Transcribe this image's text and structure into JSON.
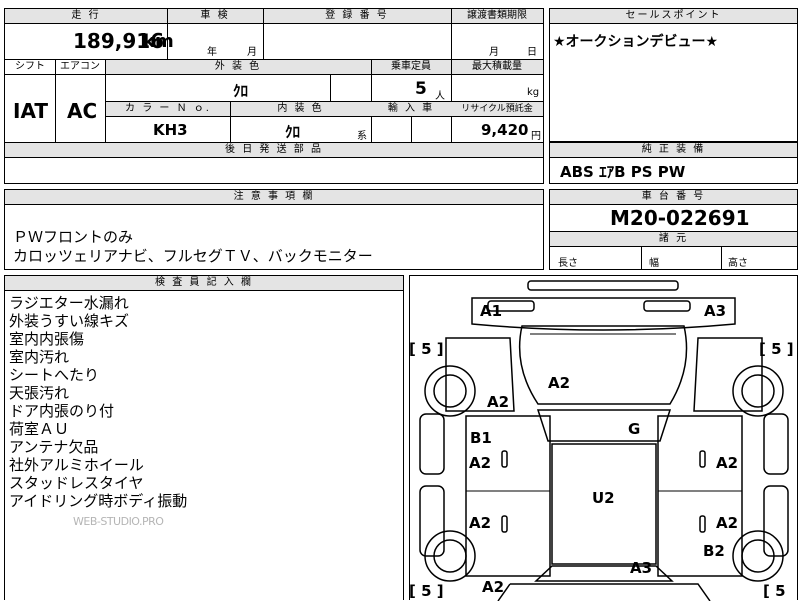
{
  "main": {
    "mileage_header": "走 行",
    "mileage_value": "189,916",
    "mileage_unit": "km",
    "inspection_header": "車 検",
    "inspection_year": "年",
    "inspection_month": "月",
    "registration_header": "登 録 番 号",
    "transfer_header": "譲渡書類期限",
    "transfer_month": "月",
    "transfer_day": "日",
    "shift_header": "シフト",
    "shift_value": "IAT",
    "aircon_header": "エアコン",
    "aircon_value": "AC",
    "exterior_color_header": "外 装 色",
    "exterior_color_value": "ｸﾛ",
    "capacity_header": "乗車定員",
    "capacity_value": "5",
    "capacity_unit": "人",
    "max_load_header": "最大積載量",
    "max_load_unit": "kg",
    "color_no_header": "カ ラ ー Ｎ ｏ.",
    "color_no_value": "KH3",
    "interior_color_header": "内 装 色",
    "interior_color_value": "ｸﾛ",
    "interior_color_suffix": "系",
    "import_header": "輸 入 車",
    "recycle_header": "リサイクル預託金",
    "recycle_value": "9,420",
    "recycle_unit": "円",
    "later_parts_header": "後 日 発 送 部 品"
  },
  "sales_point": {
    "header": "セールスポイント",
    "text": "★オークションデビュー★"
  },
  "equipment": {
    "header": "純 正 装 備",
    "text": "ABS ｴｱB PS PW"
  },
  "caution": {
    "header": "注 意 事 項 欄",
    "lines": [
      "ＰＷフロントのみ",
      "カロッツェリアナビ、フルセグＴＶ、バックモニター"
    ]
  },
  "chassis": {
    "header": "車 台 番 号",
    "value": "M20-022691",
    "dims_header": "諸 元",
    "length_label": "長さ",
    "width_label": "幅",
    "height_label": "高さ"
  },
  "inspector": {
    "header": "検 査 員 記 入 欄",
    "lines": [
      "ラジエター水漏れ",
      "外装うすい線キズ",
      "室内内張傷",
      "室内汚れ",
      "シートへたり",
      "天張汚れ",
      "ドア内張のり付",
      "荷室ＡＵ",
      "アンテナ欠品",
      "社外アルミホイール",
      "スタッドレスタイヤ",
      "アイドリング時ボディ振動"
    ],
    "watermark": "WEB-STUDIO.PRO"
  },
  "diagram": {
    "labels": {
      "front_left": "A1",
      "front_right": "A3",
      "hood": "A2",
      "front_left_fender": "A2",
      "left_pillar": "B1",
      "roof_glass": "G",
      "left_front_door": "A2",
      "right_front_door": "A2",
      "roof": "U2",
      "left_rear_door": "A2",
      "right_rear_door": "A2",
      "right_pillar": "B2",
      "rear_body": "A3",
      "left_rear_fender": "A2"
    },
    "tire_tl": "[ 5 ]",
    "tire_tr": "[ 5 ]",
    "tire_bl": "[ 5 ]",
    "tire_br": "[ 5"
  }
}
